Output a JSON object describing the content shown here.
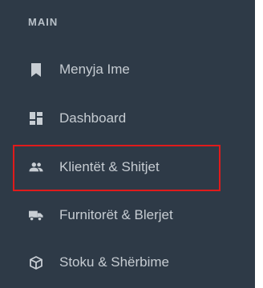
{
  "sidebar": {
    "section_title": "MAIN",
    "items": [
      {
        "label": "Menyja Ime",
        "icon": "bookmark-icon"
      },
      {
        "label": "Dashboard",
        "icon": "dashboard-icon"
      },
      {
        "label": "Klientët & Shitjet",
        "icon": "people-icon"
      },
      {
        "label": "Furnitorët & Blerjet",
        "icon": "truck-icon"
      },
      {
        "label": "Stoku & Shërbime",
        "icon": "box-icon"
      }
    ]
  },
  "colors": {
    "sidebar_bg": "#2e3a47",
    "text": "#c6ccd2",
    "icon": "#c8ced4",
    "highlight": "#e01b1b"
  }
}
